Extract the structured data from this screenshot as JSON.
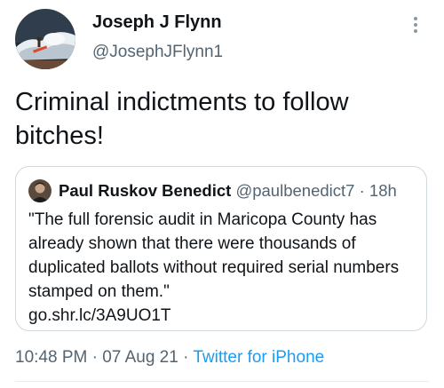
{
  "tweet": {
    "author": {
      "name": "Joseph J Flynn",
      "handle": "@JosephJFlynn1",
      "avatar_icon": "surfer-wave-photo"
    },
    "more_icon": "more-vertical-icon",
    "text": "Criminal indictments to follow bitches!",
    "quoted": {
      "author_name": "Paul Ruskov Benedict",
      "author_handle": "@paulbenedict7",
      "separator": "·",
      "time": "18h",
      "text": "\"The full forensic audit in Maricopa County has already shown that there were thousands of duplicated ballots without required serial numbers stamped on them.\"",
      "link": "go.shr.lc/3A9UO1T"
    },
    "meta": {
      "time": "10:48 PM",
      "sep1": "·",
      "date": "07 Aug 21",
      "sep2": "·",
      "source": "Twitter for iPhone"
    },
    "colors": {
      "text": "#0f1419",
      "secondary": "#536471",
      "link": "#1d9bf0",
      "border": "#cfd9de"
    }
  }
}
